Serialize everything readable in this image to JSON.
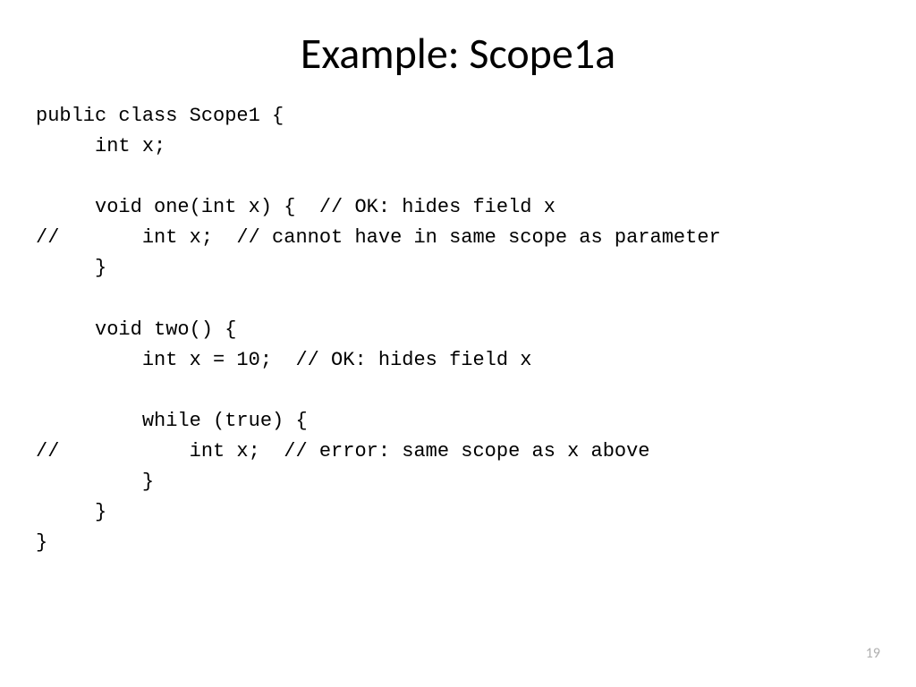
{
  "slide": {
    "title": "Example: Scope1a",
    "code_lines": [
      "public class Scope1 {",
      "     int x;",
      "",
      "     void one(int x) {  // OK: hides field x",
      "//       int x;  // cannot have in same scope as parameter",
      "     }",
      "",
      "     void two() {",
      "         int x = 10;  // OK: hides field x",
      "",
      "         while (true) {",
      "//           int x;  // error: same scope as x above",
      "         }",
      "     }",
      "}"
    ],
    "page_number": "19"
  }
}
